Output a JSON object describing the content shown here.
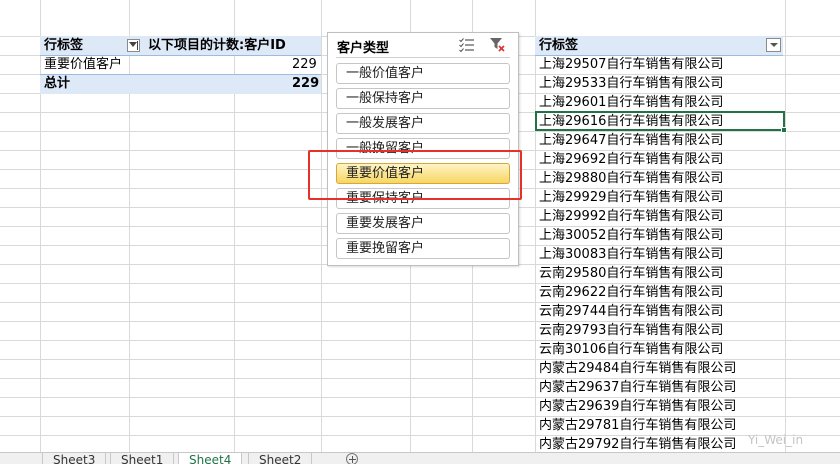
{
  "pivot": {
    "header_row_label": "行标签",
    "header_value_label": "以下项目的计数:客户ID",
    "row_label": "重要价值客户",
    "row_value": "229",
    "total_label": "总计",
    "total_value": "229"
  },
  "slicer": {
    "title": "客户类型",
    "items": [
      {
        "label": "一般价值客户",
        "selected": false
      },
      {
        "label": "一般保持客户",
        "selected": false
      },
      {
        "label": "一般发展客户",
        "selected": false
      },
      {
        "label": "一般挽留客户",
        "selected": false
      },
      {
        "label": "重要价值客户",
        "selected": true
      },
      {
        "label": "重要保持客户",
        "selected": false
      },
      {
        "label": "重要发展客户",
        "selected": false
      },
      {
        "label": "重要挽留客户",
        "selected": false
      }
    ],
    "highlight_color": "#e8302a",
    "selected_color": "#f7d662"
  },
  "customer_list": {
    "header": "行标签",
    "items": [
      "上海29507自行车销售有限公司",
      "上海29533自行车销售有限公司",
      "上海29601自行车销售有限公司",
      "上海29616自行车销售有限公司",
      "上海29647自行车销售有限公司",
      "上海29692自行车销售有限公司",
      "上海29880自行车销售有限公司",
      "上海29929自行车销售有限公司",
      "上海29992自行车销售有限公司",
      "上海30052自行车销售有限公司",
      "上海30083自行车销售有限公司",
      "云南29580自行车销售有限公司",
      "云南29622自行车销售有限公司",
      "云南29744自行车销售有限公司",
      "云南29793自行车销售有限公司",
      "云南30106自行车销售有限公司",
      "内蒙古29484自行车销售有限公司",
      "内蒙古29637自行车销售有限公司",
      "内蒙古29639自行车销售有限公司",
      "内蒙古29781自行车销售有限公司",
      "内蒙古29792自行车销售有限公司"
    ]
  },
  "sheet_tabs": [
    {
      "label": "Sheet3",
      "active": false
    },
    {
      "label": "Sheet1",
      "active": false
    },
    {
      "label": "Sheet4",
      "active": true
    },
    {
      "label": "Sheet2",
      "active": false
    }
  ],
  "watermark": "Yi_Wei_in",
  "colors": {
    "accent": "#217346",
    "header_fill": "#dde9f7"
  }
}
